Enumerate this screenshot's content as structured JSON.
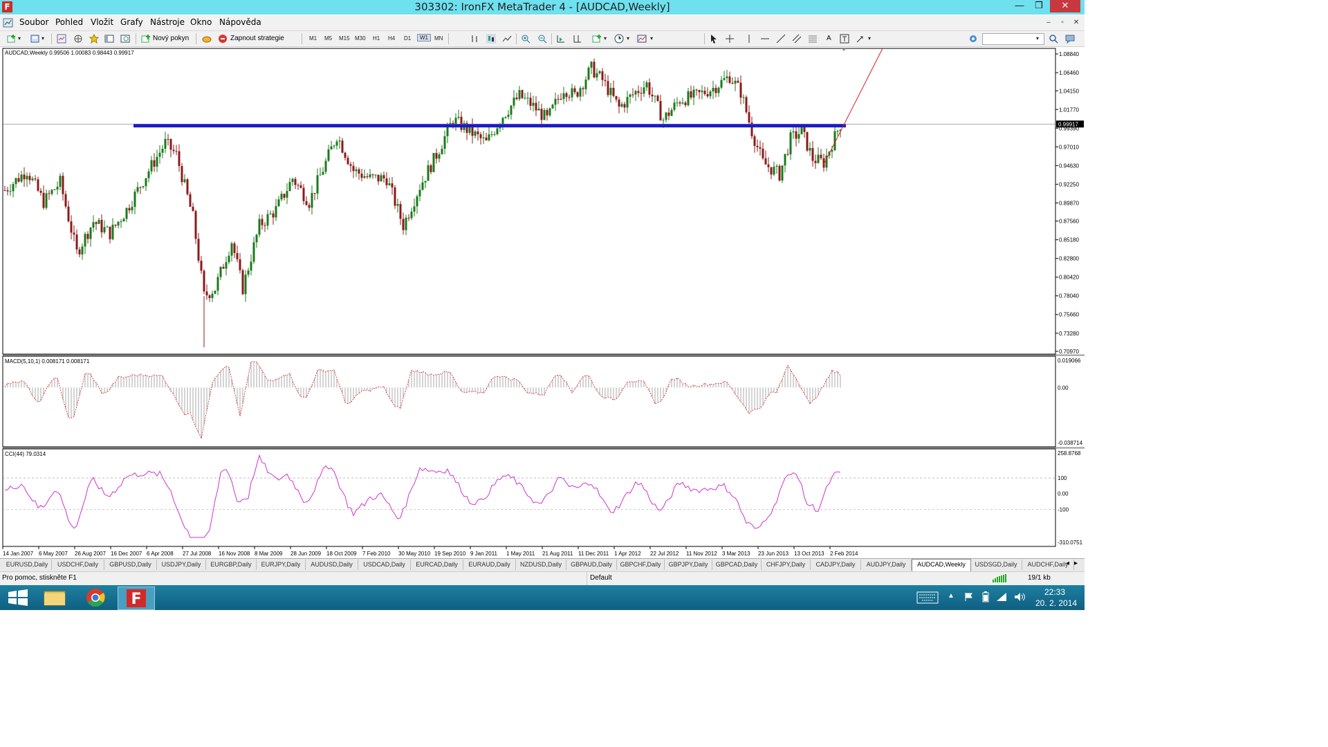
{
  "window": {
    "title": "303302: IronFX MetaTrader 4 - [AUDCAD,Weekly]",
    "app_icon_letter": "F",
    "min_label": "—",
    "max_label": "❐",
    "close_label": "✕"
  },
  "menu": {
    "items": [
      "Soubor",
      "Pohled",
      "Vložit",
      "Grafy",
      "Nástroje",
      "Okno",
      "Nápověda"
    ],
    "mdi_min": "–",
    "mdi_restore": "▫",
    "mdi_close": "✕"
  },
  "toolbar": {
    "new_order": "Nový pokyn",
    "strategy": "Zapnout strategie",
    "timeframes": [
      "M1",
      "M5",
      "M15",
      "M30",
      "H1",
      "H4",
      "D1",
      "W1",
      "MN"
    ],
    "active_timeframe": "W1"
  },
  "chart": {
    "symbol_info": "AUDCAD,Weekly  0.99506 1.00083 0.98443 0.99917",
    "current_price": "0.99917",
    "price_ticks": [
      "1.08840",
      "1.06460",
      "1.04150",
      "1.01770",
      "0.99390",
      "0.97010",
      "0.94630",
      "0.92250",
      "0.89870",
      "0.87560",
      "0.85180",
      "0.82800",
      "0.80420",
      "0.78040",
      "0.75660",
      "0.73280",
      "0.70970"
    ],
    "date_ticks": [
      "14 Jan 2007",
      "6 May 2007",
      "26 Aug 2007",
      "16 Dec 2007",
      "6 Apr 2008",
      "27 Jul 2008",
      "16 Nov 2008",
      "8 Mar 2009",
      "28 Jun 2009",
      "18 Oct 2009",
      "7 Feb 2010",
      "30 May 2010",
      "19 Sep 2010",
      "9 Jan 2011",
      "1 May 2011",
      "21 Aug 2011",
      "11 Dec 2011",
      "1 Apr 2012",
      "22 Jul 2012",
      "11 Nov 2012",
      "3 Mar 2013",
      "23 Jun 2013",
      "13 Oct 2013",
      "2 Feb 2014"
    ],
    "macd_label": "MACD(5,10,1) 0.008171 0.008171",
    "macd_ticks": [
      "0.019066",
      "0.00",
      "-0.038714"
    ],
    "cci_label": "CCI(44) 79.0314",
    "cci_ticks": [
      "258.8768",
      "100",
      "0.00",
      "-100",
      "-310.0751"
    ],
    "colors": {
      "up": "#1a7a1a",
      "down": "#8b1a1a",
      "support": "#1a1acc",
      "trend": "#e01e1e",
      "cci": "#cc33cc",
      "macd_signal": "#cc2222"
    }
  },
  "tabs": [
    "EURUSD,Daily",
    "USDCHF,Daily",
    "GBPUSD,Daily",
    "USDJPY,Daily",
    "EURGBP,Daily",
    "EURJPY,Daily",
    "AUDUSD,Daily",
    "USDCAD,Daily",
    "EURCAD,Daily",
    "EURAUD,Daily",
    "NZDUSD,Daily",
    "GBPAUD,Daily",
    "GBPCHF,Daily",
    "GBPJPY,Daily",
    "GBPCAD,Daily",
    "CHFJPY,Daily",
    "CADJPY,Daily",
    "AUDJPY,Daily",
    "AUDCAD,Weekly",
    "USDSGD,Daily",
    "AUDCHF,Daily"
  ],
  "active_tab": "AUDCAD,Weekly",
  "status": {
    "help": "Pro pomoc, stiskněte F1",
    "profile": "Default",
    "traffic": "19/1 kb"
  },
  "taskbar": {
    "time": "22:33",
    "date": "20. 2. 2014"
  }
}
